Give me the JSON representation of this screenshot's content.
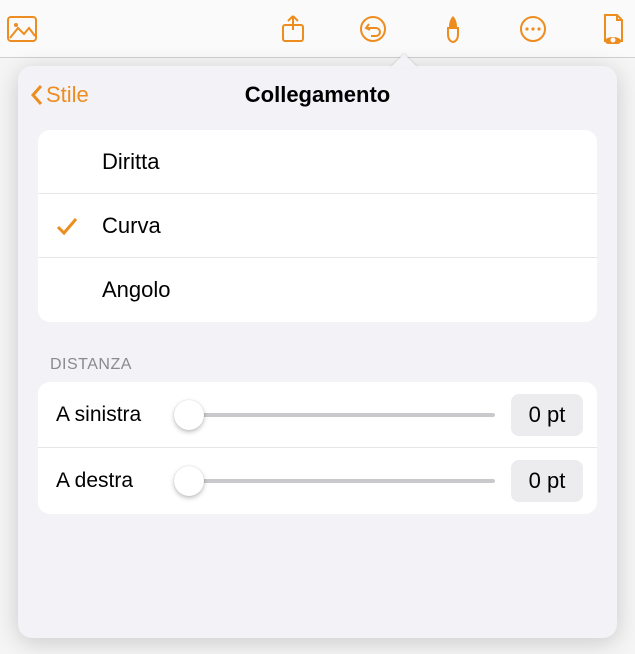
{
  "colors": {
    "accent": "#ee8d1f"
  },
  "header": {
    "back_label": "Stile",
    "title": "Collegamento"
  },
  "connection_types": {
    "items": [
      {
        "label": "Diritta",
        "selected": false
      },
      {
        "label": "Curva",
        "selected": true
      },
      {
        "label": "Angolo",
        "selected": false
      }
    ]
  },
  "distance": {
    "section_label": "DISTANZA",
    "rows": [
      {
        "label": "A sinistra",
        "value": "0 pt",
        "position": 0
      },
      {
        "label": "A destra",
        "value": "0 pt",
        "position": 0
      }
    ]
  }
}
